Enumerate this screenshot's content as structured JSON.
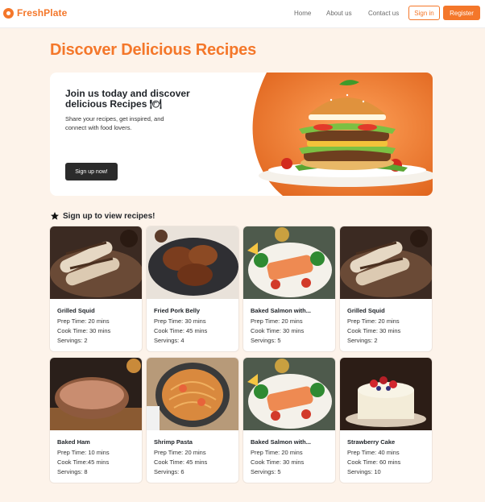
{
  "brand": {
    "name": "FreshPlate",
    "logo_icon": "chef-badge-icon",
    "accent": "#f4772a"
  },
  "nav": {
    "links": [
      "Home",
      "About us",
      "Contact us"
    ],
    "signin": "Sign in",
    "register": "Register"
  },
  "page": {
    "title": "Discover Delicious Recipes"
  },
  "hero": {
    "title": "Join us today and discover delicious Recipes 🍽",
    "text": "Share your recipes, get inspired, and connect with food lovers.",
    "button": "Sign up now!"
  },
  "section": {
    "title": "Sign up to view recipes!",
    "icon": "star-icon"
  },
  "recipes": [
    {
      "name": "Grilled Squid",
      "prep": "Prep Time: 20 mins",
      "cook": "Cook Time: 30 mins",
      "serv": "Servings: 2"
    },
    {
      "name": "Fried Pork Belly",
      "prep": "Prep Time: 30 mins",
      "cook": "Cook Time: 45 mins",
      "serv": "Servings: 4"
    },
    {
      "name": "Baked Salmon with...",
      "prep": "Prep Time: 20 mins",
      "cook": "Cook Time: 30 mins",
      "serv": "Servings: 5"
    },
    {
      "name": "Grilled Squid",
      "prep": "Prep Time: 20 mins",
      "cook": "Cook Time: 30 mins",
      "serv": "Servings: 2"
    },
    {
      "name": "Baked Ham",
      "prep": "Prep Time: 10 mins",
      "cook": "Cook Time:45 mins",
      "serv": "Servings: 8"
    },
    {
      "name": "Shrimp Pasta",
      "prep": "Prep Time: 20 mins",
      "cook": "Cook Time: 45 mins",
      "serv": "Servings: 6"
    },
    {
      "name": "Baked Salmon with...",
      "prep": "Prep Time: 20 mins",
      "cook": "Cook Time: 30 mins",
      "serv": "Servings: 5"
    },
    {
      "name": "Strawberry Cake",
      "prep": "Prep Time: 40 mins",
      "cook": "Cook Time: 60 mins",
      "serv": "Servings: 10"
    }
  ]
}
